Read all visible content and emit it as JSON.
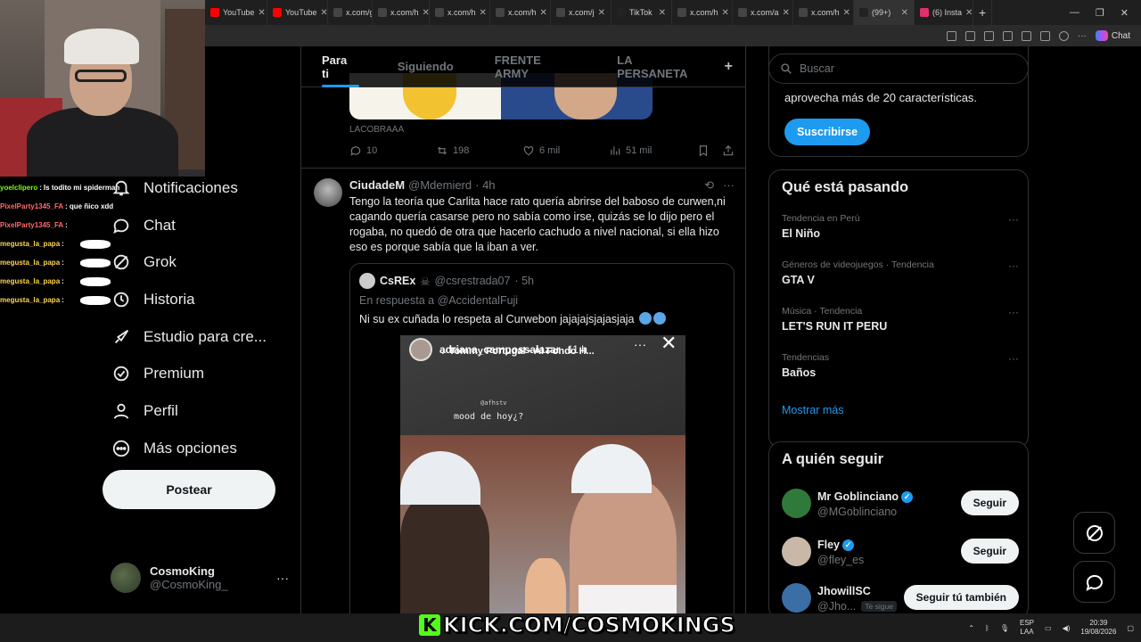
{
  "browser": {
    "tabs": [
      {
        "label": "YouTube",
        "icon": "youtube-icon",
        "color": "#ff0000"
      },
      {
        "label": "YouTube",
        "icon": "youtube-icon",
        "color": "#ff0000"
      },
      {
        "label": "x.com/g",
        "icon": "x-icon",
        "color": "#444444"
      },
      {
        "label": "x.com/h",
        "icon": "x-icon",
        "color": "#444444"
      },
      {
        "label": "x.com/h",
        "icon": "x-icon",
        "color": "#444444"
      },
      {
        "label": "x.com/h",
        "icon": "x-icon",
        "color": "#444444"
      },
      {
        "label": "x.com/j",
        "icon": "x-icon",
        "color": "#444444"
      },
      {
        "label": "TikTok",
        "icon": "tiktok-icon",
        "color": "#222222"
      },
      {
        "label": "x.com/h",
        "icon": "x-icon",
        "color": "#444444"
      },
      {
        "label": "x.com/a",
        "icon": "x-icon",
        "color": "#444444"
      },
      {
        "label": "x.com/h",
        "icon": "x-icon",
        "color": "#444444"
      },
      {
        "label": "(99+)",
        "icon": "tiktok-icon",
        "color": "#222222"
      },
      {
        "label": "(6) Insta",
        "icon": "instagram-icon",
        "color": "#e1306c"
      }
    ],
    "copilot_label": "Chat"
  },
  "stream_chat": [
    {
      "user": "yoelclipero",
      "text": "Is todito mi spiderman",
      "color": "#7cfc00"
    },
    {
      "user": "PixelParty1345_FA",
      "text": "que ñico xdd",
      "color": "#ff6b6b"
    },
    {
      "user": "PixelParty1345_FA",
      "text": "",
      "color": "#ff6b6b"
    },
    {
      "user": "megusta_la_papa",
      "text": "",
      "color": "#ffd54f"
    },
    {
      "user": "megusta_la_papa",
      "text": "",
      "color": "#ffd54f"
    },
    {
      "user": "megusta_la_papa",
      "text": "",
      "color": "#ffd54f"
    },
    {
      "user": "megusta_la_papa",
      "text": "",
      "color": "#ffd54f"
    }
  ],
  "nav": {
    "items": [
      {
        "label": "Notificaciones",
        "icon": "bell-icon"
      },
      {
        "label": "Chat",
        "icon": "chat-icon"
      },
      {
        "label": "Grok",
        "icon": "grok-icon"
      },
      {
        "label": "Historia",
        "icon": "history-icon"
      },
      {
        "label": "Estudio para cre...",
        "icon": "rocket-icon"
      },
      {
        "label": "Premium",
        "icon": "verified-icon"
      },
      {
        "label": "Perfil",
        "icon": "person-icon"
      },
      {
        "label": "Más opciones",
        "icon": "more-circle-icon"
      }
    ],
    "post_button": "Postear",
    "profile": {
      "name": "CosmoKing",
      "handle": "@CosmoKing_"
    }
  },
  "feed": {
    "tabs": [
      "Para ti",
      "Siguiendo",
      "FRENTE ARMY",
      "LA PERSANETA"
    ],
    "prev_post": {
      "source": "LACOBRAAA",
      "replies": "10",
      "reposts": "198",
      "likes": "6 mil",
      "views": "51 mil"
    },
    "tweet": {
      "name": "CiudadeM",
      "handle": "@Mdemierd",
      "time": "· 4h",
      "text": "Tengo la teoría que Carlita hace rato quería abrirse del baboso de curwen,ni cagando quería casarse pero no sabía como irse, quizás se lo dijo pero el rogaba, no quedó de otra que hacerlo cachudo a nivel nacional, si ella hizo eso es porque sabía que la iban a ver.",
      "quote": {
        "name": "CsREx",
        "handle": "@csrestrada07",
        "time": "· 5h",
        "reply_prefix": "En respuesta a",
        "reply_to": "@AccidentalFuji",
        "text": "Ni su ex cuñada lo respeta al Curwebon jajajajsjajasjaja",
        "story": {
          "user": "adriana_campossalazar",
          "time": "11 h",
          "song": "Tommy Portugal · Al Fondo H...",
          "tag": "@afhstv",
          "caption": "mood de hoy¿?"
        }
      }
    }
  },
  "sidebar": {
    "search_placeholder": "Buscar",
    "premium_text": "aprovecha más de 20 características.",
    "subscribe": "Suscribirse",
    "trends_title": "Qué está pasando",
    "trends": [
      {
        "meta": "Tendencia en Perú",
        "name": "El Niño"
      },
      {
        "meta": "Géneros de videojuegos · Tendencia",
        "name": "GTA V"
      },
      {
        "meta": "Música · Tendencia",
        "name": "LET'S RUN IT PERU"
      },
      {
        "meta": "Tendencias",
        "name": "Baños"
      }
    ],
    "show_more": "Mostrar más",
    "follow_title": "A quién seguir",
    "follow": [
      {
        "name": "Mr Goblinciano",
        "handle": "@MGoblinciano",
        "button": "Seguir",
        "verified": true,
        "badge": "",
        "color": "#2f7a3a"
      },
      {
        "name": "Fley",
        "handle": "@fley_es",
        "button": "Seguir",
        "verified": true,
        "badge": "",
        "color": "#c9b8a8"
      },
      {
        "name": "JhowillSC",
        "handle": "@Jho...",
        "button": "Seguir tú también",
        "verified": false,
        "badge": "Te sigue",
        "color": "#3a6ea5"
      }
    ]
  },
  "overlay": {
    "kick_url": "KICK.COM/COSMOKINGS"
  },
  "taskbar": {
    "lang": "ESP",
    "layout": "LAA",
    "time": "20:39",
    "date": "19/08/2026"
  }
}
